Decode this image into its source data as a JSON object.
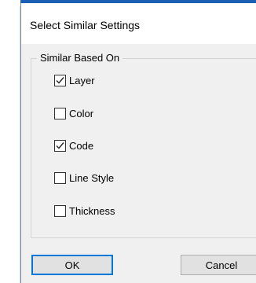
{
  "dialog": {
    "title": "Select Similar Settings"
  },
  "group": {
    "legend": "Similar Based On",
    "options": [
      {
        "label": "Layer",
        "checked": true
      },
      {
        "label": "Color",
        "checked": false
      },
      {
        "label": "Code",
        "checked": true
      },
      {
        "label": "Line Style",
        "checked": false
      },
      {
        "label": "Thickness",
        "checked": false
      }
    ]
  },
  "buttons": {
    "ok_label": "OK",
    "cancel_label": "Cancel"
  },
  "colors": {
    "accent": "#0078d7",
    "title_accent": "#1d5fb3",
    "dialog_bg": "#f0f0f0"
  },
  "icons": {
    "check": "check-icon"
  }
}
